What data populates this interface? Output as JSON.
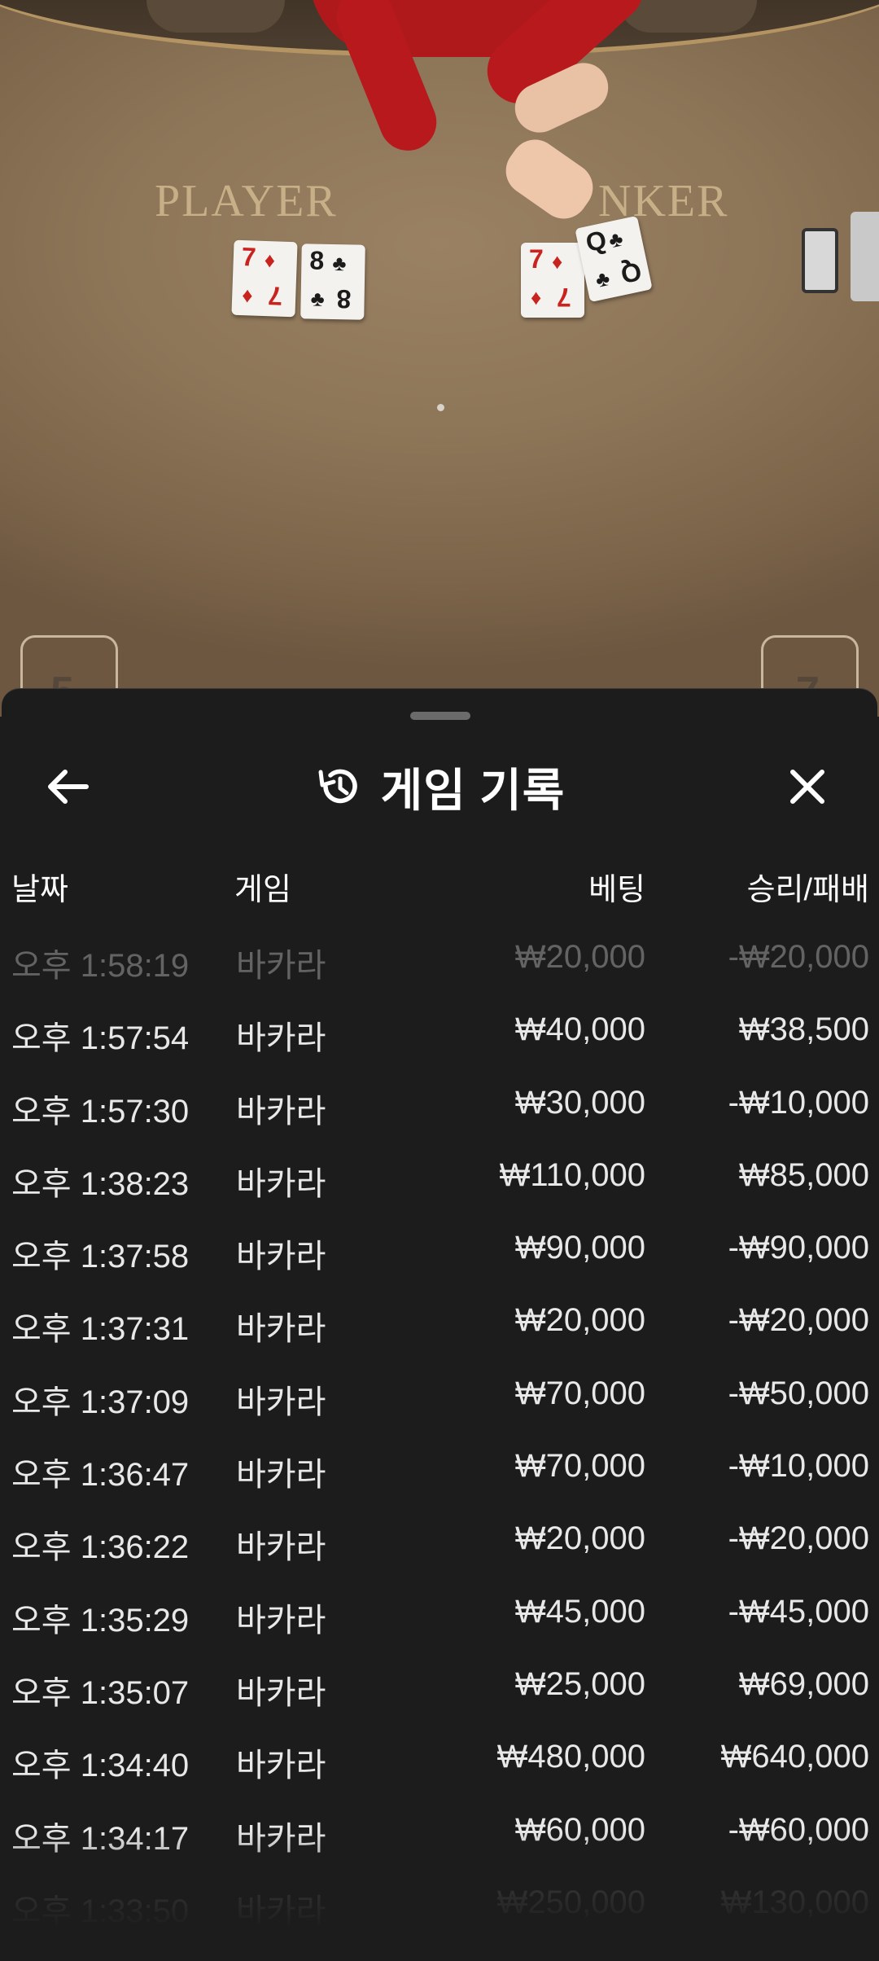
{
  "table": {
    "player_label": "PLAYER",
    "banker_label": "NKER",
    "player_cards": [
      {
        "rank": "7",
        "suit": "♦",
        "color": "red"
      },
      {
        "rank": "8",
        "suit": "♣",
        "color": "black"
      }
    ],
    "banker_cards": [
      {
        "rank": "7",
        "suit": "♦",
        "color": "red"
      },
      {
        "rank": "Q",
        "suit": "♣",
        "color": "black"
      }
    ],
    "seat_left": "5",
    "seat_right": "7"
  },
  "sheet": {
    "title": "게임 기록",
    "back_icon": "arrow-left-icon",
    "history_icon": "history-icon",
    "close_icon": "close-icon",
    "columns": {
      "date": "날짜",
      "game": "게임",
      "bet": "베팅",
      "result": "승리/패배"
    },
    "rows": [
      {
        "date": "오후 1:58:19",
        "game": "바카라",
        "bet": "₩20,000",
        "result": "-₩20,000"
      },
      {
        "date": "오후 1:57:54",
        "game": "바카라",
        "bet": "₩40,000",
        "result": "₩38,500"
      },
      {
        "date": "오후 1:57:30",
        "game": "바카라",
        "bet": "₩30,000",
        "result": "-₩10,000"
      },
      {
        "date": "오후 1:38:23",
        "game": "바카라",
        "bet": "₩110,000",
        "result": "₩85,000"
      },
      {
        "date": "오후 1:37:58",
        "game": "바카라",
        "bet": "₩90,000",
        "result": "-₩90,000"
      },
      {
        "date": "오후 1:37:31",
        "game": "바카라",
        "bet": "₩20,000",
        "result": "-₩20,000"
      },
      {
        "date": "오후 1:37:09",
        "game": "바카라",
        "bet": "₩70,000",
        "result": "-₩50,000"
      },
      {
        "date": "오후 1:36:47",
        "game": "바카라",
        "bet": "₩70,000",
        "result": "-₩10,000"
      },
      {
        "date": "오후 1:36:22",
        "game": "바카라",
        "bet": "₩20,000",
        "result": "-₩20,000"
      },
      {
        "date": "오후 1:35:29",
        "game": "바카라",
        "bet": "₩45,000",
        "result": "-₩45,000"
      },
      {
        "date": "오후 1:35:07",
        "game": "바카라",
        "bet": "₩25,000",
        "result": "₩69,000"
      },
      {
        "date": "오후 1:34:40",
        "game": "바카라",
        "bet": "₩480,000",
        "result": "₩640,000"
      },
      {
        "date": "오후 1:34:17",
        "game": "바카라",
        "bet": "₩60,000",
        "result": "-₩60,000"
      },
      {
        "date": "오후 1:33:50",
        "game": "바카라",
        "bet": "₩250,000",
        "result": "₩130,000"
      }
    ]
  }
}
